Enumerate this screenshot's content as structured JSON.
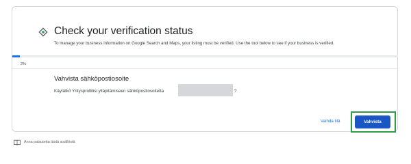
{
  "header": {
    "title": "Check your verification status",
    "subtitle": "To manage your business information on Google Search and Maps, your listing must be verified. Use the tool below to see if your business is verified."
  },
  "progress": {
    "value_percent": 2,
    "label": "2%"
  },
  "section": {
    "title": "Vahvista sähköpostiosoite",
    "question_prefix": "Käytätkö Yritysprofiilisi ylläpitämiseen sähköpostiosoitetta",
    "question_suffix": "?"
  },
  "actions": {
    "change_label": "Vaihda tilä",
    "confirm_label": "Vahvista"
  },
  "footer": {
    "feedback_label": "Anna palautetta tästä sisällöstä"
  },
  "colors": {
    "accent": "#1a73e8",
    "confirm_button": "#1a57c4",
    "highlight": "#2e9e46"
  },
  "icons": {
    "header": "diamond-icon",
    "feedback": "book-icon"
  }
}
